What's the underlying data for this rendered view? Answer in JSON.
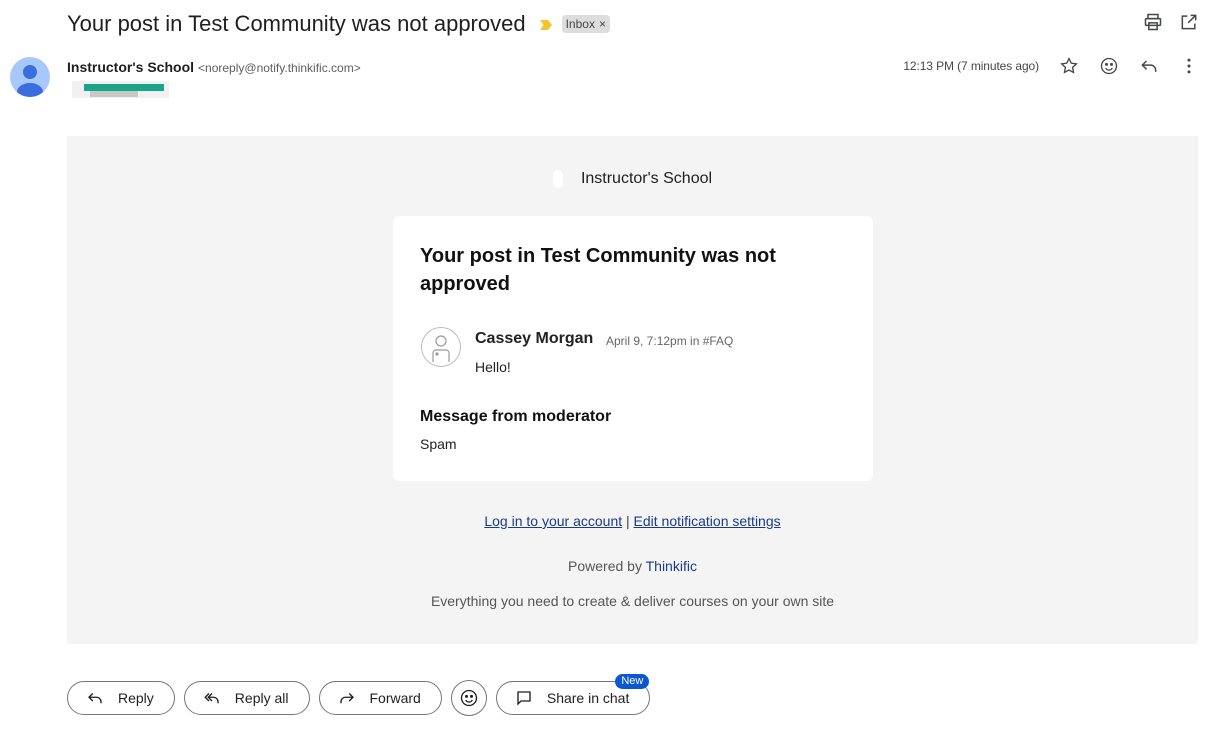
{
  "subject": "Your post in Test Community was not approved",
  "label": {
    "name": "Inbox",
    "remove": "×"
  },
  "colors": {
    "importance": "#f4c430",
    "link": "#1a3a8a",
    "badge": "#0b57d0",
    "avatar": "#a8c7fa",
    "email_bg": "#f4f4f4"
  },
  "top_icons": [
    "print-icon",
    "open-in-new-window-icon"
  ],
  "sender": {
    "name": "Instructor's School",
    "email": "<noreply@notify.thinkific.com>"
  },
  "timestamp": "12:13 PM (7 minutes ago)",
  "meta_icons": [
    "star-icon",
    "emoji-icon",
    "reply-icon",
    "more-options-icon"
  ],
  "body": {
    "school_name": "Instructor's School",
    "card": {
      "title": "Your post in Test Community was not approved",
      "author": "Cassey Morgan",
      "meta": "April 9, 7:12pm in #FAQ",
      "message": "Hello!",
      "mod_heading": "Message from moderator",
      "mod_text": "Spam"
    },
    "links": {
      "login": "Log in to your account",
      "separator": " | ",
      "settings": "Edit notification settings"
    },
    "powered_by_prefix": "Powered by ",
    "powered_by_brand": "Thinkific",
    "tagline": "Everything you need to create & deliver courses on your own site"
  },
  "actions": {
    "reply": "Reply",
    "reply_all": "Reply all",
    "forward": "Forward",
    "share": "Share in chat",
    "new_badge": "New"
  }
}
